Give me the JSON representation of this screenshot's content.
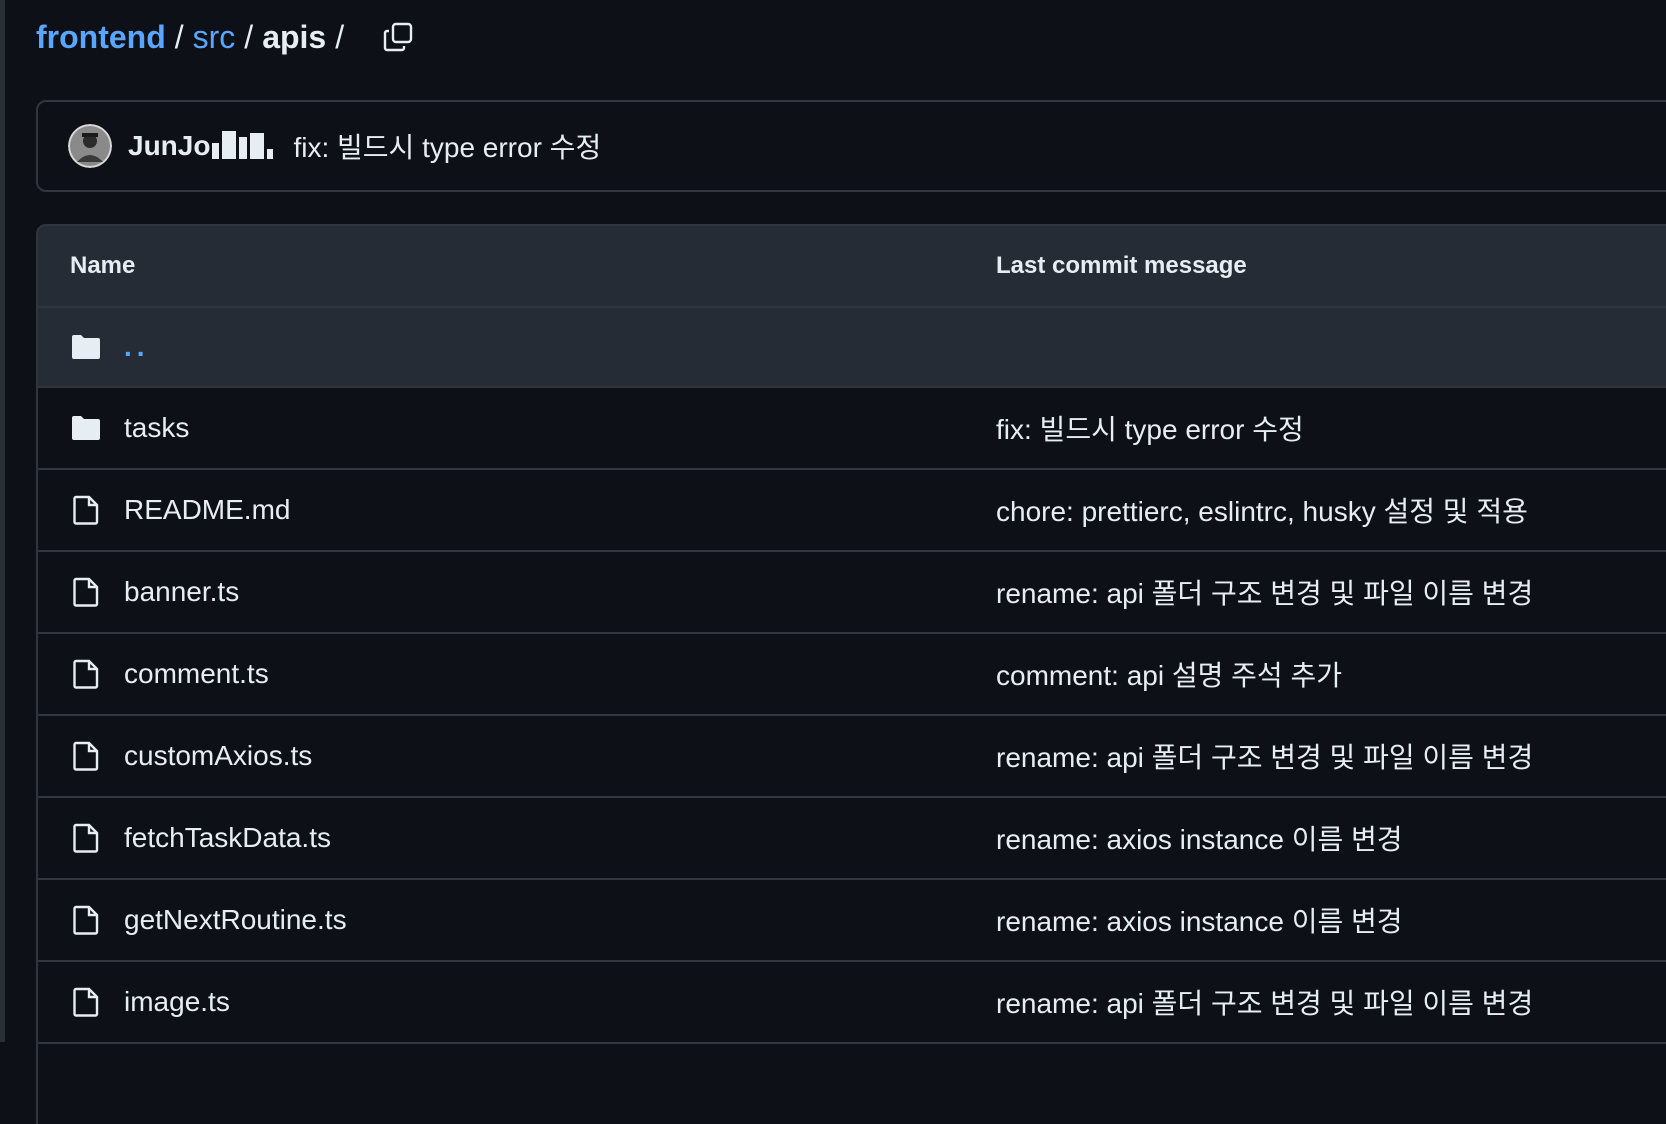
{
  "breadcrumb": {
    "parts": [
      "frontend",
      "src",
      "apis"
    ],
    "separator": "/"
  },
  "latest_commit": {
    "author": "JunJo",
    "message": "fix: 빌드시 type error 수정"
  },
  "table": {
    "headers": {
      "name": "Name",
      "message": "Last commit message"
    },
    "parent_link": "..",
    "rows": [
      {
        "type": "folder",
        "name": "tasks",
        "message": "fix: 빌드시 type error 수정"
      },
      {
        "type": "file",
        "name": "README.md",
        "message": "chore: prettierc, eslintrc, husky 설정 및 적용"
      },
      {
        "type": "file",
        "name": "banner.ts",
        "message": "rename: api 폴더 구조 변경 및 파일 이름 변경"
      },
      {
        "type": "file",
        "name": "comment.ts",
        "message": "comment: api 설명 주석 추가"
      },
      {
        "type": "file",
        "name": "customAxios.ts",
        "message": "rename: api 폴더 구조 변경 및 파일 이름 변경"
      },
      {
        "type": "file",
        "name": "fetchTaskData.ts",
        "message": "rename: axios instance 이름 변경"
      },
      {
        "type": "file",
        "name": "getNextRoutine.ts",
        "message": "rename: axios instance 이름 변경"
      },
      {
        "type": "file",
        "name": "image.ts",
        "message": "rename: api 폴더 구조 변경 및 파일 이름 변경"
      }
    ]
  },
  "colors": {
    "background": "#0d1117",
    "header_bg": "#262c36",
    "border": "#30363d",
    "link": "#58a6ff",
    "text": "#e6edf3",
    "icon_fill": "#e6edf3"
  },
  "icons": {
    "copy": "copy-icon",
    "folder": "folder-icon",
    "file": "file-icon"
  }
}
